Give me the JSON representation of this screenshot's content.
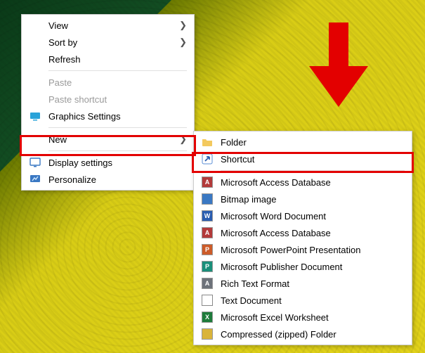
{
  "main_menu": {
    "view": {
      "label": "View"
    },
    "sort_by": {
      "label": "Sort by"
    },
    "refresh": {
      "label": "Refresh"
    },
    "paste": {
      "label": "Paste"
    },
    "paste_shortcut": {
      "label": "Paste shortcut"
    },
    "graphics": {
      "label": "Graphics Settings"
    },
    "new": {
      "label": "New"
    },
    "display": {
      "label": "Display settings"
    },
    "personalize": {
      "label": "Personalize"
    }
  },
  "sub_menu": {
    "folder": {
      "label": "Folder"
    },
    "shortcut": {
      "label": "Shortcut"
    },
    "access1": {
      "label": "Microsoft Access Database"
    },
    "bmp": {
      "label": "Bitmap image"
    },
    "word": {
      "label": "Microsoft Word Document"
    },
    "access2": {
      "label": "Microsoft Access Database"
    },
    "ppt": {
      "label": "Microsoft PowerPoint Presentation"
    },
    "pub": {
      "label": "Microsoft Publisher Document"
    },
    "rtf": {
      "label": "Rich Text Format"
    },
    "txt": {
      "label": "Text Document"
    },
    "excel": {
      "label": "Microsoft Excel Worksheet"
    },
    "zip": {
      "label": "Compressed (zipped) Folder"
    }
  },
  "annotation": {
    "arrow_color": "#e30000",
    "highlight_color": "#e30000"
  }
}
